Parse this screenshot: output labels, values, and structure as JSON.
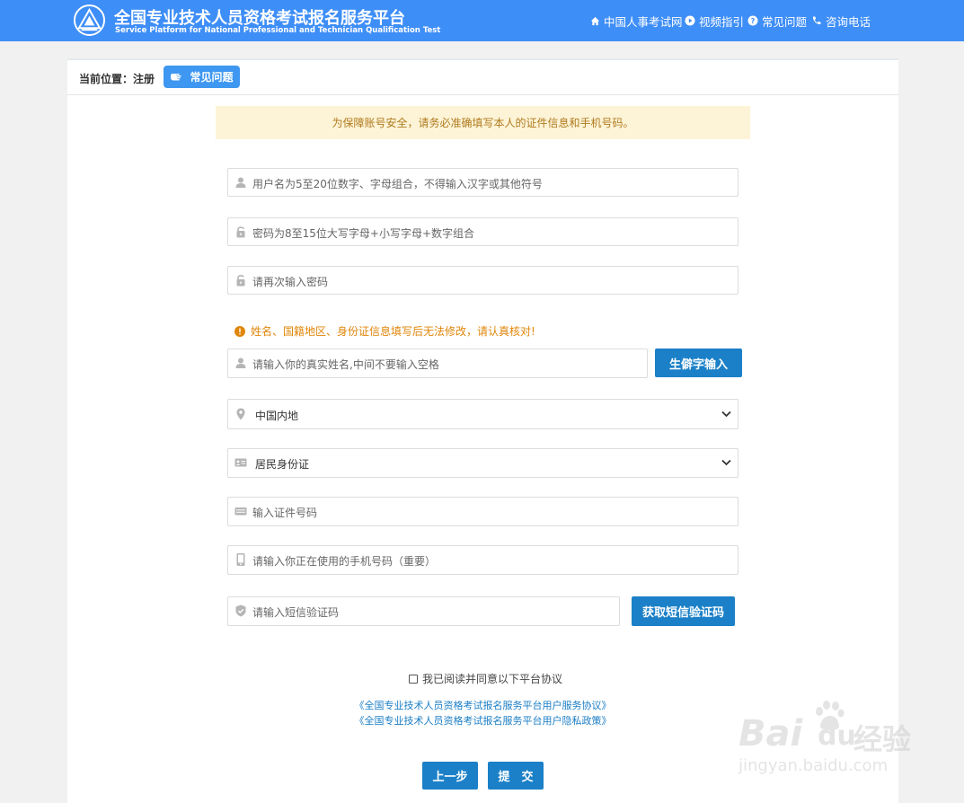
{
  "header": {
    "title_cn": "全国专业技术人员资格考试报名服务平台",
    "title_en": "Service Platform for National Professional and Technician Qualification Test",
    "nav": [
      {
        "label": "中国人事考试网",
        "icon": "home-icon"
      },
      {
        "label": "视频指引",
        "icon": "play-icon"
      },
      {
        "label": "常见问题",
        "icon": "help-icon"
      },
      {
        "label": "咨询电话",
        "icon": "phone-icon"
      }
    ]
  },
  "breadcrumb": {
    "label": "当前位置：注册",
    "faq_button": "常见问题"
  },
  "notice": "为保障账号安全，请务必准确填写本人的证件信息和手机号码。",
  "form": {
    "username_placeholder": "用户名为5至20位数字、字母组合，不得输入汉字或其他符号",
    "password_placeholder": "密码为8至15位大写字母+小写字母+数字组合",
    "password_confirm_placeholder": "请再次输入密码",
    "identity_warning": "姓名、国籍地区、身份证信息填写后无法修改，请认真核对!",
    "realname_placeholder": "请输入你的真实姓名,中间不要输入空格",
    "rare_char_button": "生僻字输入",
    "region_value": "中国内地",
    "idtype_value": "居民身份证",
    "idnumber_placeholder": "输入证件号码",
    "phone_placeholder": "请输入你正在使用的手机号码（重要）",
    "sms_placeholder": "请输入短信验证码",
    "sms_button": "获取短信验证码",
    "agree_label": "我已阅读并同意以下平台协议",
    "agreement_service": "《全国专业技术人员资格考试报名服务平台用户服务协议》",
    "agreement_privacy": "《全国专业技术人员资格考试报名服务平台用户隐私政策》",
    "prev_button": "上一步",
    "submit_button": "提　交"
  },
  "watermark": {
    "brand": "Bai",
    "brand2": "du",
    "brand_cn": "经验",
    "url": "jingyan.baidu.com"
  },
  "colors": {
    "header_bg": "#3e8ef7",
    "button_blue": "#1b80c7",
    "warning": "#e0860a",
    "notice_bg": "#fdf4d7",
    "link": "#1a7dc4"
  }
}
